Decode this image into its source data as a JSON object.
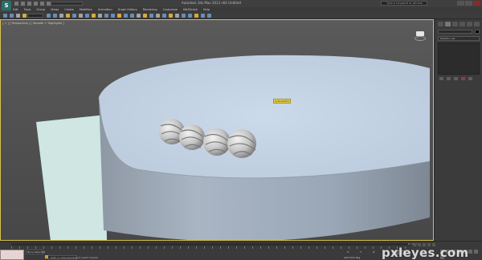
{
  "titlebar": {
    "logo_text": "S",
    "title": "Autodesk 3ds Max 2013 x64    Untitled",
    "search_placeholder": "Type a keyword or phrase"
  },
  "menu": [
    "Edit",
    "Tools",
    "Group",
    "Views",
    "Create",
    "Modifiers",
    "Animation",
    "Graph Editors",
    "Rendering",
    "Customize",
    "MAXScript",
    "Help"
  ],
  "viewport": {
    "label": "[ + ] [ Perspective ] [ Smooth + Highlights ]",
    "object_label": "Cylinder001"
  },
  "command_panel": {
    "modifier_list": "Modifier List"
  },
  "timeline": {
    "frame_counter": "0 / 100"
  },
  "status": {
    "selection": "None Selected",
    "prompt": "Click or click-and-drag to select objects",
    "x_label": "X:",
    "y_label": "Y:",
    "z_label": "Z:",
    "grid_label": "Grid = 10,0",
    "add_time_tag": "Add Time Tag",
    "auto_key": "Auto Key",
    "set_key": "Set Key"
  },
  "watermark": "pxleyes.com",
  "colors": {
    "viewport_bg": "#525252",
    "cylinder_top": "#c5d5e6",
    "ground": "#cfe6e2",
    "label_bg": "#e7d34a",
    "active_border": "#d9c24a"
  }
}
